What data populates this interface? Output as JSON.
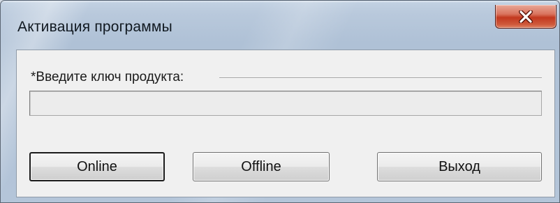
{
  "window": {
    "title": "Активация программы",
    "close_icon": "close-x-icon"
  },
  "form": {
    "key_label": "*Введите ключ продукта:",
    "key_value": "",
    "key_placeholder": ""
  },
  "buttons": {
    "online_label": "Online",
    "offline_label": "Offline",
    "exit_label": "Выход"
  },
  "colors": {
    "close_button": "#c2381f",
    "client_background": "#f0f0f0",
    "frame": "#b9c9dc"
  }
}
